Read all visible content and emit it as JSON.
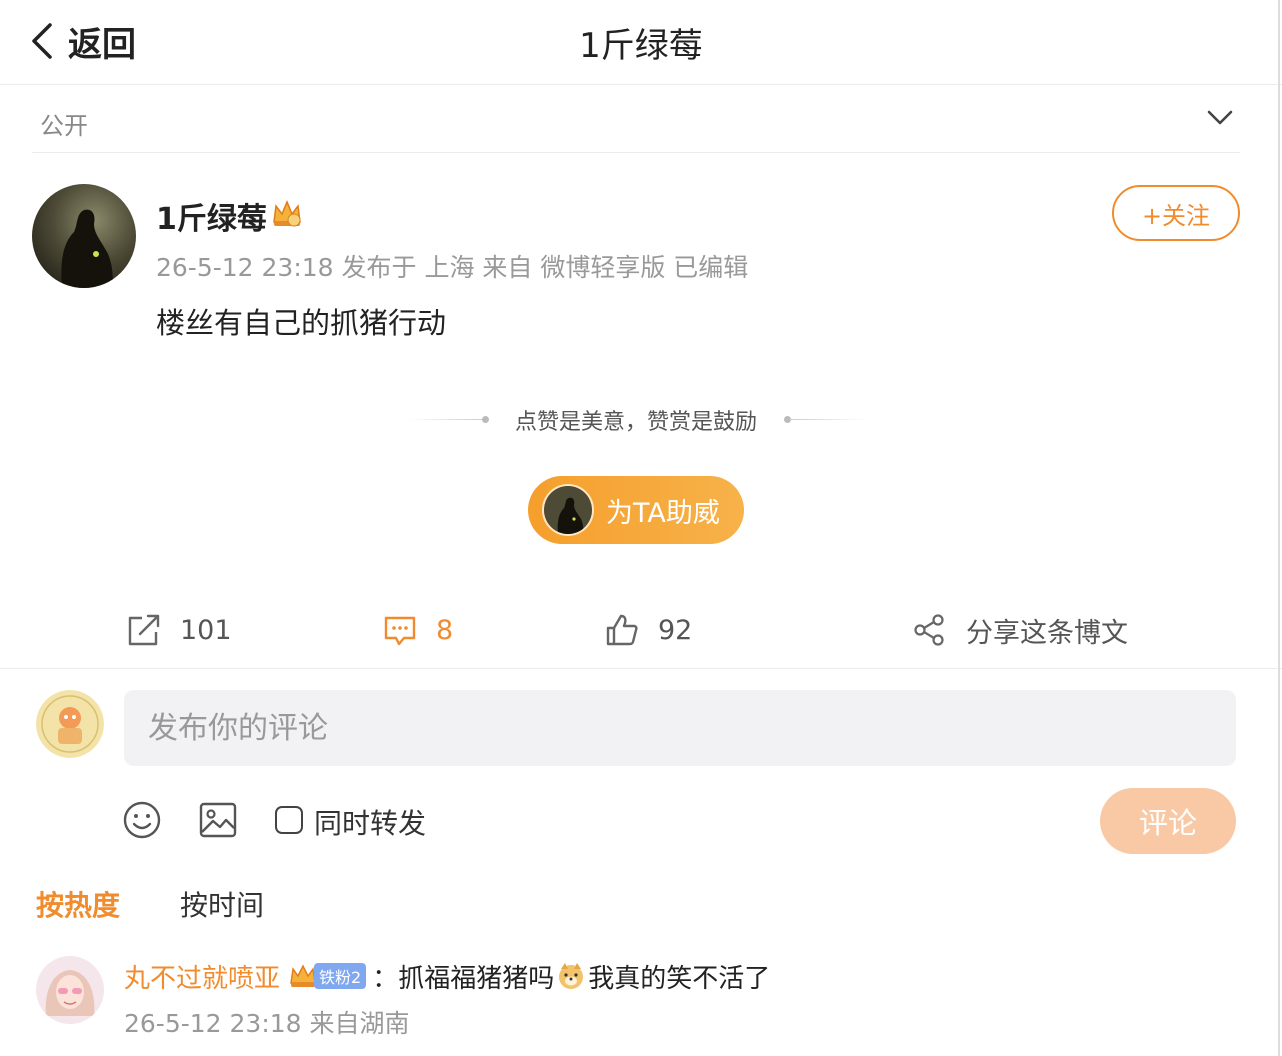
{
  "header": {
    "back_label": "返回",
    "title": "1斤绿莓"
  },
  "visibility": {
    "label": "公开"
  },
  "post": {
    "author": "1斤绿莓",
    "meta": "26-5-12 23:18 发布于 上海 来自 微博轻享版 已编辑",
    "text": "楼丝有自己的抓猪行动",
    "follow_label": "+关注"
  },
  "reward": {
    "tagline": "点赞是美意，赞赏是鼓励",
    "cheer_label": "为TA助威"
  },
  "actions": {
    "repost_count": "101",
    "comment_count": "8",
    "like_count": "92",
    "share_label": "分享这条博文"
  },
  "composer": {
    "placeholder": "发布你的评论",
    "repost_label": "同时转发",
    "submit_label": "评论"
  },
  "sort": {
    "hot": "按热度",
    "time": "按时间"
  },
  "comments": [
    {
      "user": "丸不过就喷亚",
      "fan_badge": "铁粉2",
      "text_before": "：抓福福猪猪吗",
      "text_after": "我真的笑不活了",
      "meta": "26-5-12 23:18 来自湖南"
    }
  ],
  "colors": {
    "accent": "#f08c2e",
    "submit_disabled": "#f8c9a4",
    "input_bg": "#f2f2f4"
  },
  "icons": [
    "back-arrow-icon",
    "chevron-down-icon",
    "crown-icon",
    "repost-icon",
    "comment-icon",
    "like-icon",
    "share-icon",
    "emoji-icon",
    "image-icon",
    "dog-emoji-icon"
  ]
}
